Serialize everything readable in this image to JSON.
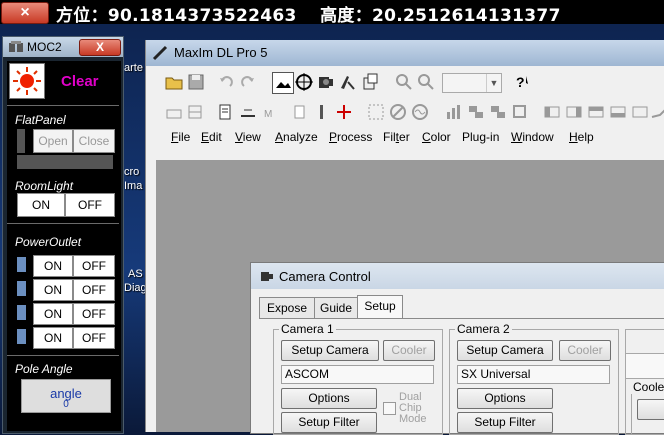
{
  "topbar": {
    "close_label": "×",
    "coords_text": "方位：90.1814373522463　 高度：20.2512614131377"
  },
  "desktop": {
    "labels": [
      "arte",
      "cro",
      "Ima",
      "AS",
      "Diag"
    ]
  },
  "moc": {
    "title": "MOC2",
    "close_label": "X",
    "status": "Clear",
    "status_color": "#e000c8",
    "flatpanel": {
      "label": "FlatPanel",
      "open": "Open",
      "close": "Close"
    },
    "roomlight": {
      "label": "RoomLight",
      "on": "ON",
      "off": "OFF"
    },
    "poweroutlet": {
      "label": "PowerOutlet",
      "on": "ON",
      "off": "OFF",
      "count": 4
    },
    "poleangle": {
      "label": "Pole Angle",
      "value": "angle",
      "value2": "0"
    }
  },
  "maxim": {
    "title": "MaxIm DL Pro 5",
    "menus": [
      "File",
      "Edit",
      "View",
      "Analyze",
      "Process",
      "Filter",
      "Color",
      "Plug-in",
      "Window",
      "Help"
    ],
    "menu_mnemonics": [
      "F",
      "E",
      "V",
      "A",
      "P",
      "t",
      "C",
      "g",
      "W",
      "H"
    ]
  },
  "camera_control": {
    "title": "Camera Control",
    "tabs": [
      "Expose",
      "Guide",
      "Setup"
    ],
    "active_tab": "Setup",
    "camera1": {
      "label": "Camera 1",
      "setup_button": "Setup Camera",
      "cooler_button": "Cooler",
      "driver": "ASCOM",
      "options_button": "Options",
      "filter_button": "Setup Filter",
      "dual_chip_label": "Dual Chip Mode"
    },
    "camera2": {
      "label": "Camera 2",
      "setup_button": "Setup Camera",
      "cooler_button": "Cooler",
      "driver": "SX Universal",
      "options_button": "Options",
      "filter_button": "Setup Filter"
    },
    "cooler_group_label": "Cooler"
  }
}
